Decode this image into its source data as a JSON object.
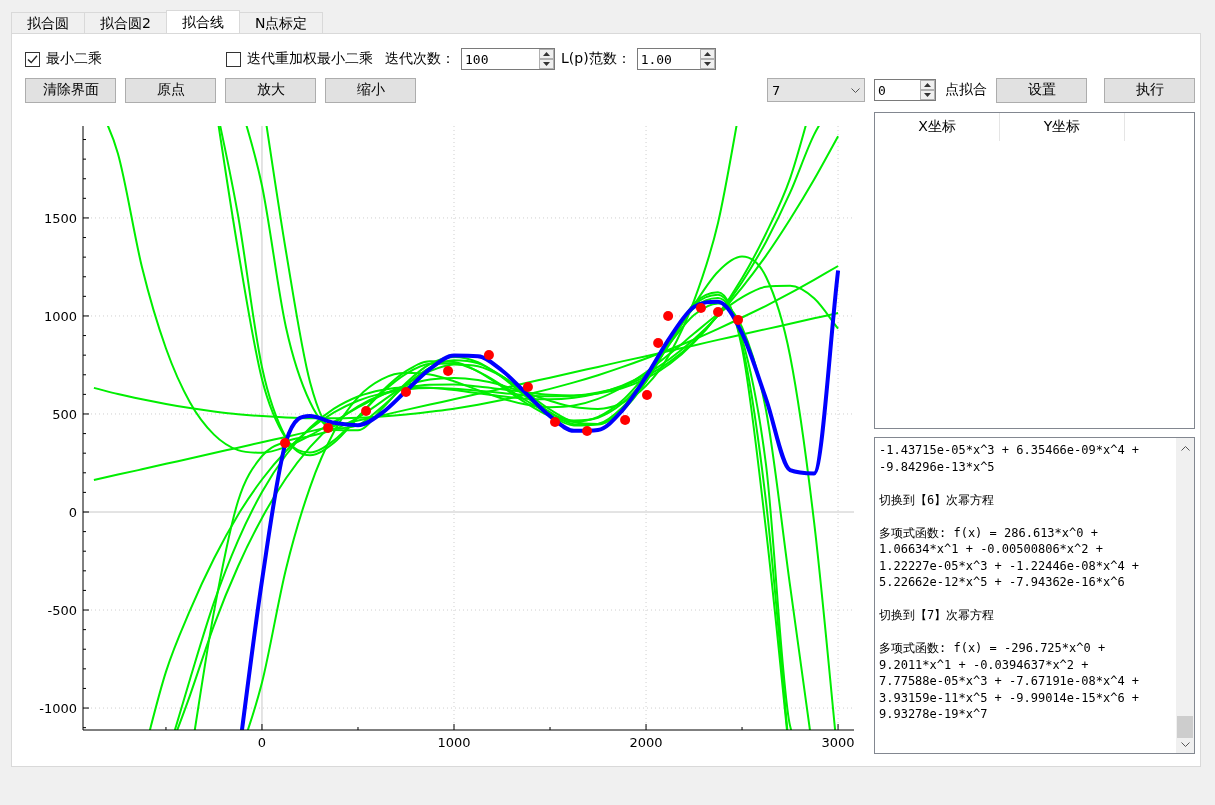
{
  "tabs": [
    {
      "label": "拟合圆",
      "selected": false
    },
    {
      "label": "拟合圆2",
      "selected": false
    },
    {
      "label": "拟合线",
      "selected": true
    },
    {
      "label": "N点标定",
      "selected": false
    }
  ],
  "options": {
    "least_squares": {
      "label": "最小二乘",
      "checked": true
    },
    "irls": {
      "label": "迭代重加权最小二乘",
      "checked": false
    },
    "iterations": {
      "label": "迭代次数：",
      "value": "100"
    },
    "lp_norm": {
      "label": "L(p)范数：",
      "value": "1.00"
    }
  },
  "buttons": [
    "清除界面",
    "原点",
    "放大",
    "缩小"
  ],
  "fit_controls": {
    "degree": "7",
    "point_count": "0",
    "point_label": "点拟合",
    "buttons": [
      "设置",
      "执行"
    ]
  },
  "chart": {
    "chart_data": {
      "type": "line",
      "grid": true,
      "xlim": [
        -932,
        3083
      ],
      "ylim": [
        -1112,
        1969
      ],
      "xticks": [
        0,
        1000,
        2000,
        3000
      ],
      "yticks": [
        -1000,
        -500,
        0,
        500,
        1000,
        1500
      ],
      "x": [
        -875,
        -750,
        -625,
        -500,
        -375,
        -250,
        -125,
        0,
        125,
        250,
        375,
        500,
        625,
        750,
        875,
        1000,
        1125,
        1250,
        1375,
        1500,
        1625,
        1750,
        1875,
        2000,
        2125,
        2250,
        2375,
        2500,
        2625,
        2750,
        2875,
        3000
      ],
      "series": [
        {
          "color": "#00ee00",
          "values": [
            163,
            191,
            218,
            246,
            273,
            301,
            328,
            356,
            383,
            411,
            438,
            466,
            493,
            521,
            548,
            575,
            603,
            630,
            658,
            685,
            713,
            740,
            768,
            795,
            823,
            850,
            878,
            905,
            933,
            960,
            988,
            1015
          ]
        },
        {
          "color": "#00ee00",
          "values": [
            633,
            602,
            575,
            551,
            530,
            513,
            499,
            489,
            482,
            478,
            478,
            481,
            487,
            497,
            511,
            527,
            547,
            571,
            598,
            628,
            661,
            698,
            739,
            783,
            830,
            880,
            934,
            992,
            1052,
            1116,
            1184,
            1255
          ]
        },
        {
          "color": "#00ee00",
          "values": [
            null,
            null,
            null,
            -814,
            -502,
            -237,
            -15,
            166,
            311,
            424,
            508,
            567,
            605,
            625,
            632,
            629,
            619,
            607,
            596,
            590,
            593,
            609,
            640,
            692,
            767,
            869,
            1003,
            1172,
            1379,
            1629,
            1925,
            null
          ]
        },
        {
          "color": "#00ee00",
          "values": [
            null,
            null,
            null,
            null,
            -853,
            -461,
            -146,
            102,
            291,
            430,
            527,
            589,
            623,
            636,
            634,
            622,
            606,
            590,
            578,
            575,
            583,
            606,
            645,
            703,
            782,
            881,
            1002,
            1144,
            1308,
            1493,
            1696,
            1917
          ]
        },
        {
          "color": "#00ee00",
          "values": [
            null,
            null,
            null,
            null,
            null,
            null,
            1514,
            738,
            379,
            290,
            353,
            482,
            616,
            718,
            769,
            765,
            716,
            639,
            556,
            489,
            460,
            485,
            567,
            701,
            861,
            1005,
            1064,
            943,
            516,
            -377,
            null,
            null
          ]
        },
        {
          "color": "#00ee00",
          "values": [
            null,
            null,
            null,
            null,
            null,
            -508,
            55,
            285,
            360,
            387,
            421,
            482,
            564,
            650,
            718,
            752,
            743,
            691,
            610,
            523,
            459,
            449,
            515,
            663,
            868,
            1063,
            1121,
            836,
            -95,
            null,
            null,
            null
          ]
        },
        {
          "color": "#00ee00",
          "values": [
            null,
            null,
            null,
            null,
            -935,
            -578,
            -278,
            -30,
            172,
            331,
            452,
            539,
            598,
            633,
            649,
            650,
            640,
            626,
            610,
            598,
            594,
            604,
            631,
            680,
            756,
            864,
            1007,
            1192,
            1422,
            1702,
            null,
            null
          ]
        },
        {
          "color": "#00ee00",
          "values": [
            null,
            null,
            null,
            null,
            null,
            null,
            null,
            -870,
            -290,
            126,
            409,
            585,
            678,
            710,
            701,
            667,
            622,
            579,
            548,
            534,
            543,
            577,
            635,
            713,
            808,
            910,
            1010,
            1095,
            1149,
            1154,
            1090,
            935
          ]
        },
        {
          "color": "#00ee00",
          "values": [
            null,
            null,
            null,
            null,
            null,
            null,
            null,
            null,
            1329,
            663,
            418,
            417,
            527,
            658,
            755,
            791,
            764,
            688,
            588,
            495,
            441,
            449,
            532,
            683,
            873,
            1041,
            1091,
            885,
            237,
            -1092,
            null,
            null
          ]
        },
        {
          "color": "#00ee00",
          "values": [
            null,
            null,
            null,
            null,
            null,
            null,
            null,
            1664,
            941,
            561,
            426,
            443,
            537,
            648,
            736,
            774,
            758,
            693,
            601,
            509,
            448,
            446,
            521,
            672,
            872,
            1055,
            1108,
            856,
            49,
            null,
            null,
            null
          ]
        },
        {
          "color": "#00ee00",
          "values": [
            null,
            1829,
            1248,
            834,
            559,
            395,
            316,
            302,
            332,
            390,
            461,
            533,
            597,
            646,
            676,
            684,
            673,
            646,
            607,
            567,
            535,
            526,
            556,
            643,
            809,
            1077,
            1474,
            null,
            null,
            null,
            null,
            null
          ]
        },
        {
          "color": "#00ee00",
          "values": [
            null,
            null,
            null,
            null,
            null,
            null,
            1338,
            677,
            375,
            304,
            366,
            485,
            609,
            705,
            756,
            758,
            717,
            647,
            569,
            502,
            467,
            481,
            553,
            683,
            860,
            1056,
            1226,
            1303,
            1199,
            796,
            -52,
            null
          ]
        },
        {
          "color": "#0000ff",
          "values": [
            null,
            null,
            null,
            null,
            null,
            null,
            null,
            -350,
            359,
            490,
            455,
            443,
            505,
            617,
            730,
            798,
            795,
            722,
            606,
            489,
            414,
            419,
            516,
            690,
            891,
            1046,
            1073,
            912,
            576,
            214,
            197,
            1232
          ]
        },
        {
          "type": "scatter",
          "color": "#ff0000",
          "x": [
            120,
            344,
            542,
            750,
            969,
            1182,
            1385,
            1526,
            1693,
            1891,
            2005,
            2063,
            2115,
            2286,
            2375,
            2479
          ],
          "values": [
            352,
            429,
            515,
            612,
            719,
            801,
            638,
            459,
            413,
            469,
            597,
            862,
            1000,
            1041,
            1020,
            980
          ]
        }
      ]
    }
  },
  "table": {
    "columns": [
      "X坐标",
      "Y坐标"
    ]
  },
  "log": {
    "paragraphs": [
      {
        "lines": [
          "-1.43715e-05*x^3 + 6.35466e-09*x^4 +",
          "-9.84296e-13*x^5"
        ]
      },
      {
        "lines": [
          "切换到【6】次幂方程"
        ]
      },
      {
        "lines": [
          "多项式函数: f(x) = 286.613*x^0 +",
          "1.06634*x^1 + -0.00500806*x^2 +",
          "1.22227e-05*x^3 + -1.22446e-08*x^4 +",
          "5.22662e-12*x^5 + -7.94362e-16*x^6"
        ]
      },
      {
        "lines": [
          "切换到【7】次幂方程"
        ]
      },
      {
        "lines": [
          "多项式函数: f(x) = -296.725*x^0 +",
          "9.2011*x^1 + -0.0394637*x^2 +",
          "7.77588e-05*x^3 + -7.67191e-08*x^4 +",
          "3.93159e-11*x^5 + -9.99014e-15*x^6 +",
          "9.93278e-19*x^7"
        ]
      }
    ]
  }
}
